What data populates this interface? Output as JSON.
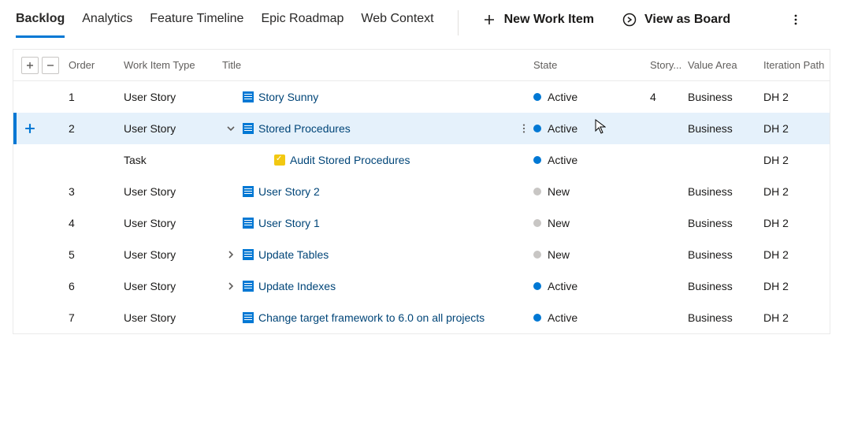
{
  "tabs": [
    "Backlog",
    "Analytics",
    "Feature Timeline",
    "Epic Roadmap",
    "Web Context"
  ],
  "actions": {
    "new_item": "New Work Item",
    "view_board": "View as Board"
  },
  "columns": {
    "order": "Order",
    "type": "Work Item Type",
    "title": "Title",
    "state": "State",
    "sp": "Story...",
    "va": "Value Area",
    "iter": "Iteration Path"
  },
  "rows": [
    {
      "order": "1",
      "type": "User Story",
      "icon": "story",
      "title": "Story Sunny",
      "state": "Active",
      "state_kind": "active",
      "sp": "4",
      "va": "Business",
      "iter": "DH 2",
      "selected": false,
      "expander": "",
      "indent": 0
    },
    {
      "order": "2",
      "type": "User Story",
      "icon": "story",
      "title": "Stored Procedures",
      "state": "Active",
      "state_kind": "active",
      "sp": "",
      "va": "Business",
      "iter": "DH 2",
      "selected": true,
      "expander": "down",
      "indent": 0
    },
    {
      "order": "",
      "type": "Task",
      "icon": "task",
      "title": "Audit Stored Procedures",
      "state": "Active",
      "state_kind": "active",
      "sp": "",
      "va": "",
      "iter": "DH 2",
      "selected": false,
      "expander": "",
      "indent": 1
    },
    {
      "order": "3",
      "type": "User Story",
      "icon": "story",
      "title": "User Story 2",
      "state": "New",
      "state_kind": "new",
      "sp": "",
      "va": "Business",
      "iter": "DH 2",
      "selected": false,
      "expander": "",
      "indent": 0
    },
    {
      "order": "4",
      "type": "User Story",
      "icon": "story",
      "title": "User Story 1",
      "state": "New",
      "state_kind": "new",
      "sp": "",
      "va": "Business",
      "iter": "DH 2",
      "selected": false,
      "expander": "",
      "indent": 0
    },
    {
      "order": "5",
      "type": "User Story",
      "icon": "story",
      "title": "Update Tables",
      "state": "New",
      "state_kind": "new",
      "sp": "",
      "va": "Business",
      "iter": "DH 2",
      "selected": false,
      "expander": "right",
      "indent": 0
    },
    {
      "order": "6",
      "type": "User Story",
      "icon": "story",
      "title": "Update Indexes",
      "state": "Active",
      "state_kind": "active",
      "sp": "",
      "va": "Business",
      "iter": "DH 2",
      "selected": false,
      "expander": "right",
      "indent": 0
    },
    {
      "order": "7",
      "type": "User Story",
      "icon": "story",
      "title": "Change target framework to 6.0 on all projects",
      "state": "Active",
      "state_kind": "active",
      "sp": "",
      "va": "Business",
      "iter": "DH 2",
      "selected": false,
      "expander": "",
      "indent": 0
    }
  ]
}
